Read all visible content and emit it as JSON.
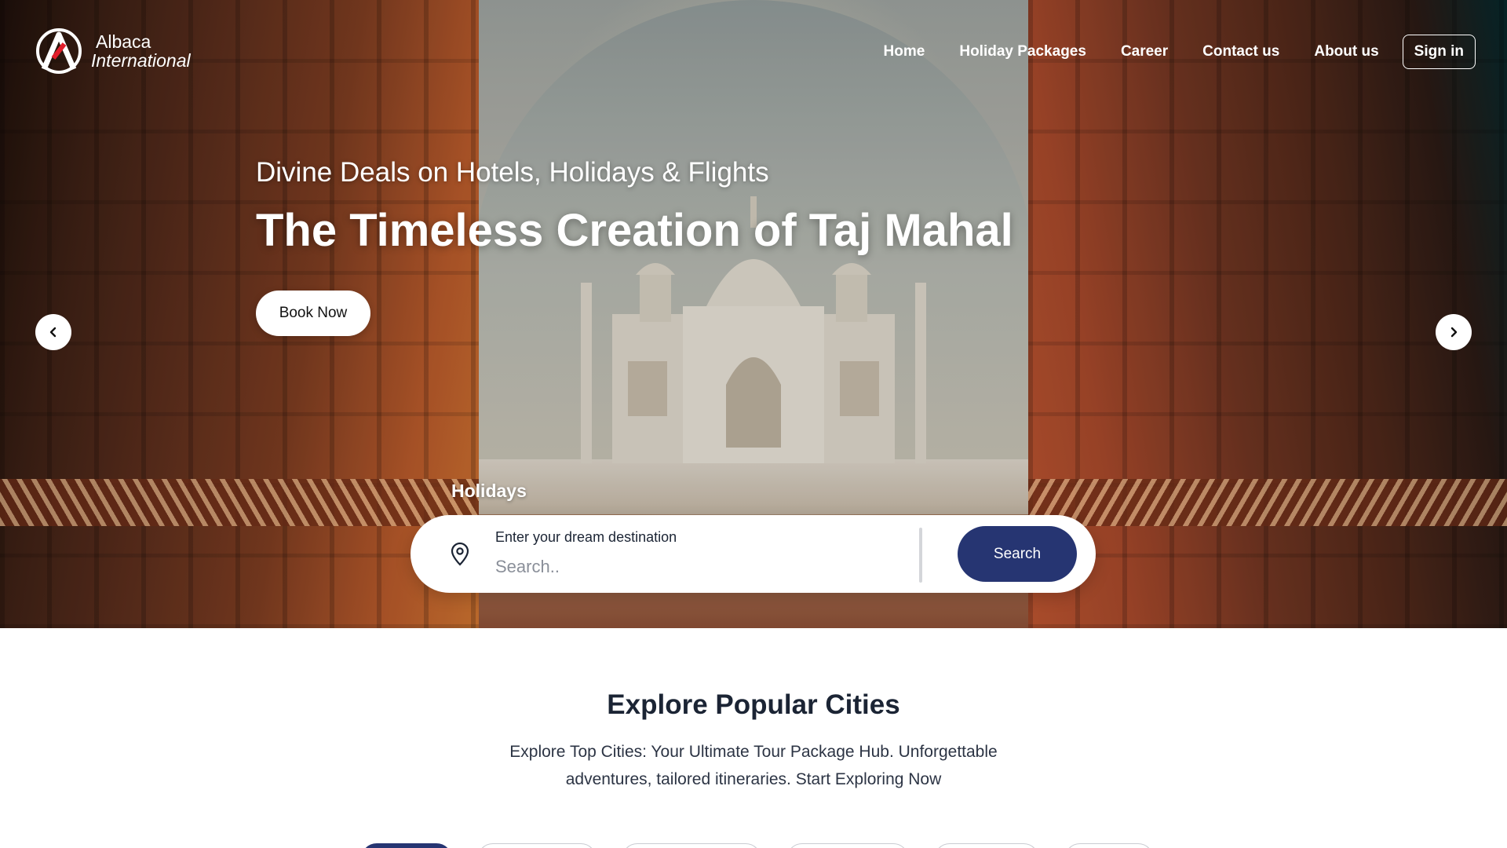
{
  "brand": {
    "line1": "Albaca",
    "line2": "International"
  },
  "nav": {
    "links": [
      "Home",
      "Holiday Packages",
      "Career",
      "Contact us",
      "About us"
    ],
    "signin_label": "Sign in"
  },
  "hero": {
    "tagline": "Divine Deals on Hotels, Holidays & Flights",
    "headline": "The Timeless Creation of Taj Mahal",
    "book_label": "Book Now",
    "prev_icon": "chevron-left-icon",
    "next_icon": "chevron-right-icon"
  },
  "search": {
    "tab_label": "Holidays",
    "caption": "Enter your dream destination",
    "placeholder": "Search..",
    "button_label": "Search",
    "icon": "location-pin-icon"
  },
  "explore": {
    "title": "Explore Popular Cities",
    "description": "Explore Top Cities: Your Ultimate Tour Package Hub. Unforgettable adventures, tailored itineraries. Start Exploring Now"
  },
  "colors": {
    "accent": "#263572",
    "text": "#1b2434",
    "white": "#ffffff"
  }
}
